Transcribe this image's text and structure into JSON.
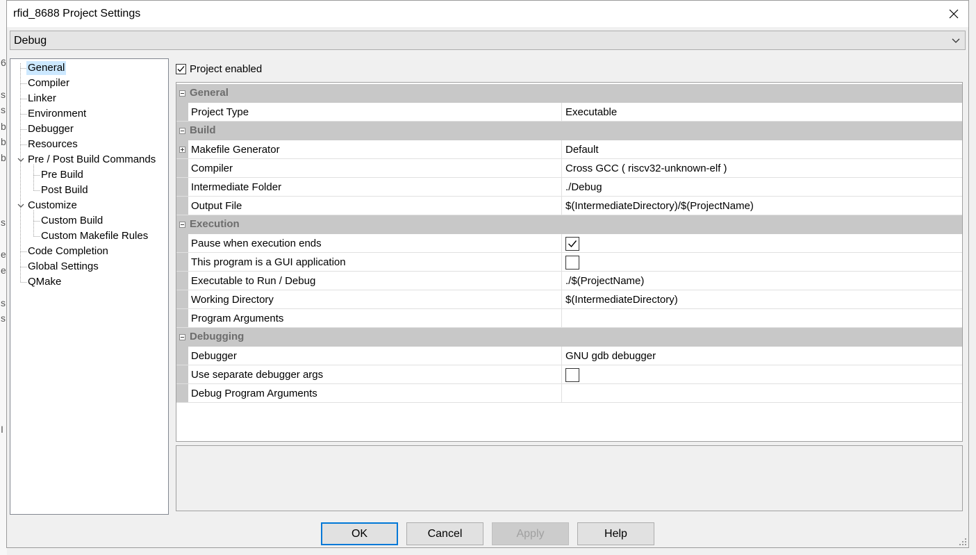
{
  "window": {
    "title": "rfid_8688 Project Settings"
  },
  "configuration": {
    "selected": "Debug"
  },
  "tree": {
    "items": [
      {
        "label": "General",
        "selected": true
      },
      {
        "label": "Compiler"
      },
      {
        "label": "Linker"
      },
      {
        "label": "Environment"
      },
      {
        "label": "Debugger"
      },
      {
        "label": "Resources"
      },
      {
        "label": "Pre / Post Build Commands",
        "expanded": true
      },
      {
        "label": "Pre Build"
      },
      {
        "label": "Post Build"
      },
      {
        "label": "Customize",
        "expanded": true
      },
      {
        "label": "Custom Build"
      },
      {
        "label": "Custom Makefile Rules"
      },
      {
        "label": "Code Completion"
      },
      {
        "label": "Global Settings"
      },
      {
        "label": "QMake"
      }
    ]
  },
  "project_enabled": {
    "label": "Project enabled",
    "checked": true
  },
  "properties": {
    "general": {
      "title": "General",
      "project_type": {
        "name": "Project Type",
        "value": "Executable"
      }
    },
    "build": {
      "title": "Build",
      "makefile_generator": {
        "name": "Makefile Generator",
        "value": "Default"
      },
      "compiler": {
        "name": "Compiler",
        "value": "Cross GCC ( riscv32-unknown-elf )"
      },
      "intermediate_folder": {
        "name": "Intermediate Folder",
        "value": "./Debug"
      },
      "output_file": {
        "name": "Output File",
        "value": "$(IntermediateDirectory)/$(ProjectName)"
      }
    },
    "execution": {
      "title": "Execution",
      "pause_when_ends": {
        "name": "Pause when execution ends",
        "checked": true
      },
      "gui_application": {
        "name": "This program is a GUI application",
        "checked": false
      },
      "executable": {
        "name": "Executable to Run / Debug",
        "value": "./$(ProjectName)"
      },
      "working_directory": {
        "name": "Working Directory",
        "value": "$(IntermediateDirectory)"
      },
      "program_arguments": {
        "name": "Program Arguments",
        "value": ""
      }
    },
    "debugging": {
      "title": "Debugging",
      "debugger": {
        "name": "Debugger",
        "value": "GNU gdb debugger"
      },
      "separate_args": {
        "name": "Use separate debugger args",
        "checked": false
      },
      "debug_program_arguments": {
        "name": "Debug Program Arguments",
        "value": ""
      }
    }
  },
  "buttons": {
    "ok": "OK",
    "cancel": "Cancel",
    "apply": "Apply",
    "help": "Help"
  },
  "background_glyphs": [
    "6",
    "s",
    "s",
    "b",
    "b",
    "b",
    "s",
    "e",
    "e",
    "s",
    "s",
    "I"
  ],
  "colors": {
    "selection": "#cce8ff",
    "section": "#c8c8c8",
    "focus_border": "#0078d7"
  }
}
